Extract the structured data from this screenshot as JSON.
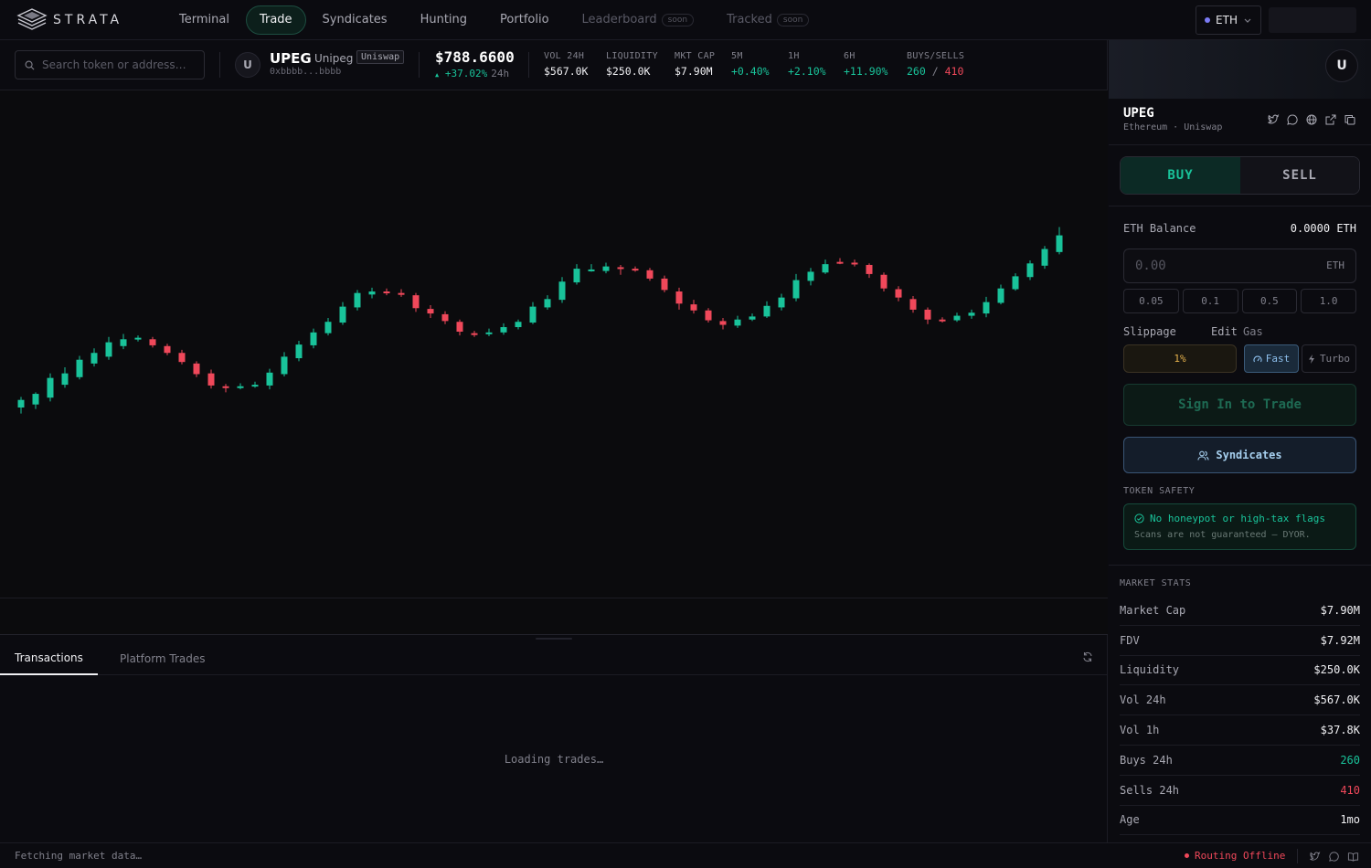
{
  "nav": {
    "logo_text": "STRATA",
    "items": [
      {
        "label": "Terminal"
      },
      {
        "label": "Trade"
      },
      {
        "label": "Syndicates"
      },
      {
        "label": "Hunting"
      },
      {
        "label": "Portfolio"
      },
      {
        "label": "Leaderboard",
        "badge": "soon"
      },
      {
        "label": "Tracked",
        "badge": "soon"
      }
    ],
    "chain": "ETH"
  },
  "search": {
    "placeholder": "Search token or address…"
  },
  "token": {
    "avatar": "U",
    "symbol": "UPEG",
    "name": "Unipeg",
    "dex": "Uniswap",
    "address": "0xbbbb...bbbb",
    "price": "$788.6600",
    "change": "+37.02%",
    "change_period": "24h"
  },
  "stats": [
    {
      "label": "VOL 24H",
      "value": "$567.0K",
      "tone": "neutral"
    },
    {
      "label": "LIQUIDITY",
      "value": "$250.0K",
      "tone": "neutral"
    },
    {
      "label": "MKT CAP",
      "value": "$7.90M",
      "tone": "neutral"
    },
    {
      "label": "5M",
      "value": "+0.40%",
      "tone": "green"
    },
    {
      "label": "1H",
      "value": "+2.10%",
      "tone": "green"
    },
    {
      "label": "6H",
      "value": "+11.90%",
      "tone": "green"
    }
  ],
  "buys_sells": {
    "label": "BUYS/SELLS",
    "buys": "260",
    "sep": "/",
    "sells": "410"
  },
  "chart_data": {
    "type": "candlestick",
    "series": [
      {
        "o": 0.0,
        "c": 0.1,
        "h": 0.14,
        "l": -0.08
      },
      {
        "o": 0.04,
        "c": 0.18,
        "h": 0.2,
        "l": -0.02
      },
      {
        "o": 0.13,
        "c": 0.39,
        "h": 0.45,
        "l": 0.08
      },
      {
        "o": 0.3,
        "c": 0.45,
        "h": 0.53,
        "l": 0.26
      },
      {
        "o": 0.4,
        "c": 0.63,
        "h": 0.68,
        "l": 0.37
      },
      {
        "o": 0.58,
        "c": 0.72,
        "h": 0.78,
        "l": 0.54
      },
      {
        "o": 0.67,
        "c": 0.86,
        "h": 0.93,
        "l": 0.63
      },
      {
        "o": 0.81,
        "c": 0.9,
        "h": 0.97,
        "l": 0.77
      },
      {
        "o": 0.9,
        "c": 0.92,
        "h": 0.95,
        "l": 0.87
      },
      {
        "o": 0.9,
        "c": 0.82,
        "h": 0.93,
        "l": 0.79
      },
      {
        "o": 0.81,
        "c": 0.72,
        "h": 0.84,
        "l": 0.69
      },
      {
        "o": 0.72,
        "c": 0.6,
        "h": 0.76,
        "l": 0.57
      },
      {
        "o": 0.58,
        "c": 0.44,
        "h": 0.61,
        "l": 0.4
      },
      {
        "o": 0.45,
        "c": 0.29,
        "h": 0.5,
        "l": 0.25
      },
      {
        "o": 0.28,
        "c": 0.26,
        "h": 0.31,
        "l": 0.2
      },
      {
        "o": 0.26,
        "c": 0.28,
        "h": 0.32,
        "l": 0.24
      },
      {
        "o": 0.28,
        "c": 0.3,
        "h": 0.34,
        "l": 0.26
      },
      {
        "o": 0.29,
        "c": 0.46,
        "h": 0.51,
        "l": 0.24
      },
      {
        "o": 0.44,
        "c": 0.67,
        "h": 0.73,
        "l": 0.41
      },
      {
        "o": 0.65,
        "c": 0.83,
        "h": 0.88,
        "l": 0.61
      },
      {
        "o": 0.82,
        "c": 0.99,
        "h": 1.04,
        "l": 0.78
      },
      {
        "o": 0.98,
        "c": 1.13,
        "h": 1.18,
        "l": 0.95
      },
      {
        "o": 1.12,
        "c": 1.33,
        "h": 1.39,
        "l": 1.09
      },
      {
        "o": 1.32,
        "c": 1.51,
        "h": 1.55,
        "l": 1.28
      },
      {
        "o": 1.49,
        "c": 1.53,
        "h": 1.58,
        "l": 1.44
      },
      {
        "o": 1.53,
        "c": 1.51,
        "h": 1.57,
        "l": 1.48
      },
      {
        "o": 1.51,
        "c": 1.49,
        "h": 1.56,
        "l": 1.46
      },
      {
        "o": 1.48,
        "c": 1.31,
        "h": 1.51,
        "l": 1.26
      },
      {
        "o": 1.3,
        "c": 1.24,
        "h": 1.35,
        "l": 1.18
      },
      {
        "o": 1.23,
        "c": 1.14,
        "h": 1.27,
        "l": 1.1
      },
      {
        "o": 1.13,
        "c": 1.0,
        "h": 1.16,
        "l": 0.95
      },
      {
        "o": 0.98,
        "c": 0.97,
        "h": 1.01,
        "l": 0.93
      },
      {
        "o": 0.97,
        "c": 0.99,
        "h": 1.04,
        "l": 0.94
      },
      {
        "o": 0.99,
        "c": 1.06,
        "h": 1.11,
        "l": 0.96
      },
      {
        "o": 1.06,
        "c": 1.13,
        "h": 1.16,
        "l": 1.03
      },
      {
        "o": 1.12,
        "c": 1.33,
        "h": 1.39,
        "l": 1.1
      },
      {
        "o": 1.32,
        "c": 1.43,
        "h": 1.48,
        "l": 1.29
      },
      {
        "o": 1.42,
        "c": 1.66,
        "h": 1.72,
        "l": 1.38
      },
      {
        "o": 1.65,
        "c": 1.83,
        "h": 1.89,
        "l": 1.62
      },
      {
        "o": 1.81,
        "c": 1.82,
        "h": 1.89,
        "l": 1.79
      },
      {
        "o": 1.8,
        "c": 1.86,
        "h": 1.91,
        "l": 1.77
      },
      {
        "o": 1.85,
        "c": 1.83,
        "h": 1.88,
        "l": 1.75
      },
      {
        "o": 1.83,
        "c": 1.82,
        "h": 1.86,
        "l": 1.79
      },
      {
        "o": 1.81,
        "c": 1.7,
        "h": 1.84,
        "l": 1.67
      },
      {
        "o": 1.7,
        "c": 1.55,
        "h": 1.74,
        "l": 1.52
      },
      {
        "o": 1.53,
        "c": 1.37,
        "h": 1.58,
        "l": 1.29
      },
      {
        "o": 1.36,
        "c": 1.28,
        "h": 1.42,
        "l": 1.24
      },
      {
        "o": 1.28,
        "c": 1.15,
        "h": 1.31,
        "l": 1.12
      },
      {
        "o": 1.14,
        "c": 1.09,
        "h": 1.18,
        "l": 1.03
      },
      {
        "o": 1.08,
        "c": 1.16,
        "h": 1.21,
        "l": 1.05
      },
      {
        "o": 1.16,
        "c": 1.2,
        "h": 1.24,
        "l": 1.14
      },
      {
        "o": 1.2,
        "c": 1.34,
        "h": 1.4,
        "l": 1.18
      },
      {
        "o": 1.32,
        "c": 1.45,
        "h": 1.5,
        "l": 1.28
      },
      {
        "o": 1.44,
        "c": 1.68,
        "h": 1.76,
        "l": 1.4
      },
      {
        "o": 1.67,
        "c": 1.79,
        "h": 1.84,
        "l": 1.61
      },
      {
        "o": 1.78,
        "c": 1.89,
        "h": 1.95,
        "l": 1.76
      },
      {
        "o": 1.92,
        "c": 1.91,
        "h": 1.97,
        "l": 1.89
      },
      {
        "o": 1.91,
        "c": 1.9,
        "h": 1.95,
        "l": 1.86
      },
      {
        "o": 1.88,
        "c": 1.76,
        "h": 1.9,
        "l": 1.71
      },
      {
        "o": 1.75,
        "c": 1.57,
        "h": 1.78,
        "l": 1.53
      },
      {
        "o": 1.56,
        "c": 1.45,
        "h": 1.6,
        "l": 1.4
      },
      {
        "o": 1.43,
        "c": 1.29,
        "h": 1.47,
        "l": 1.25
      },
      {
        "o": 1.29,
        "c": 1.16,
        "h": 1.32,
        "l": 1.1
      },
      {
        "o": 1.16,
        "c": 1.15,
        "h": 1.19,
        "l": 1.12
      },
      {
        "o": 1.15,
        "c": 1.21,
        "h": 1.25,
        "l": 1.13
      },
      {
        "o": 1.21,
        "c": 1.25,
        "h": 1.29,
        "l": 1.17
      },
      {
        "o": 1.24,
        "c": 1.39,
        "h": 1.46,
        "l": 1.19
      },
      {
        "o": 1.38,
        "c": 1.57,
        "h": 1.62,
        "l": 1.36
      },
      {
        "o": 1.56,
        "c": 1.73,
        "h": 1.77,
        "l": 1.54
      },
      {
        "o": 1.72,
        "c": 1.9,
        "h": 1.94,
        "l": 1.68
      },
      {
        "o": 1.87,
        "c": 2.09,
        "h": 2.13,
        "l": 1.83
      },
      {
        "o": 2.05,
        "c": 2.27,
        "h": 2.38,
        "l": 2.02
      }
    ],
    "up_color": "#19c39a",
    "down_color": "#f0485a"
  },
  "tabs": {
    "transactions": "Transactions",
    "platform_trades": "Platform Trades"
  },
  "trades_loading": "Loading trades…",
  "panel": {
    "avatar": "U",
    "symbol": "UPEG",
    "subtitle": "Ethereum · Uniswap",
    "buy": "BUY",
    "sell": "SELL",
    "balance_label": "ETH Balance",
    "balance_value": "0.0000 ETH",
    "amount_placeholder": "0.00",
    "amount_unit": "ETH",
    "quick_amounts": [
      "0.05",
      "0.1",
      "0.5",
      "1.0"
    ],
    "slippage_label": "Slippage",
    "edit_label": "Edit",
    "gas_label": "Gas",
    "slippage_value": "1%",
    "fast": "Fast",
    "turbo": "Turbo",
    "sign_in": "Sign In to Trade",
    "syndicates": "Syndicates",
    "safety_title": "TOKEN SAFETY",
    "safety_main": "No honeypot or high-tax flags",
    "safety_sub": "Scans are not guaranteed — DYOR."
  },
  "market_stats": {
    "title": "MARKET STATS",
    "rows": [
      {
        "k": "Market Cap",
        "v": "$7.90M",
        "tone": "neutral"
      },
      {
        "k": "FDV",
        "v": "$7.92M",
        "tone": "neutral"
      },
      {
        "k": "Liquidity",
        "v": "$250.0K",
        "tone": "neutral"
      },
      {
        "k": "Vol 24h",
        "v": "$567.0K",
        "tone": "neutral"
      },
      {
        "k": "Vol 1h",
        "v": "$37.8K",
        "tone": "neutral"
      },
      {
        "k": "Buys 24h",
        "v": "260",
        "tone": "green"
      },
      {
        "k": "Sells 24h",
        "v": "410",
        "tone": "red"
      },
      {
        "k": "Age",
        "v": "1mo",
        "tone": "neutral"
      }
    ]
  },
  "status": {
    "fetching": "Fetching market data…",
    "routing": "Routing Offline"
  }
}
